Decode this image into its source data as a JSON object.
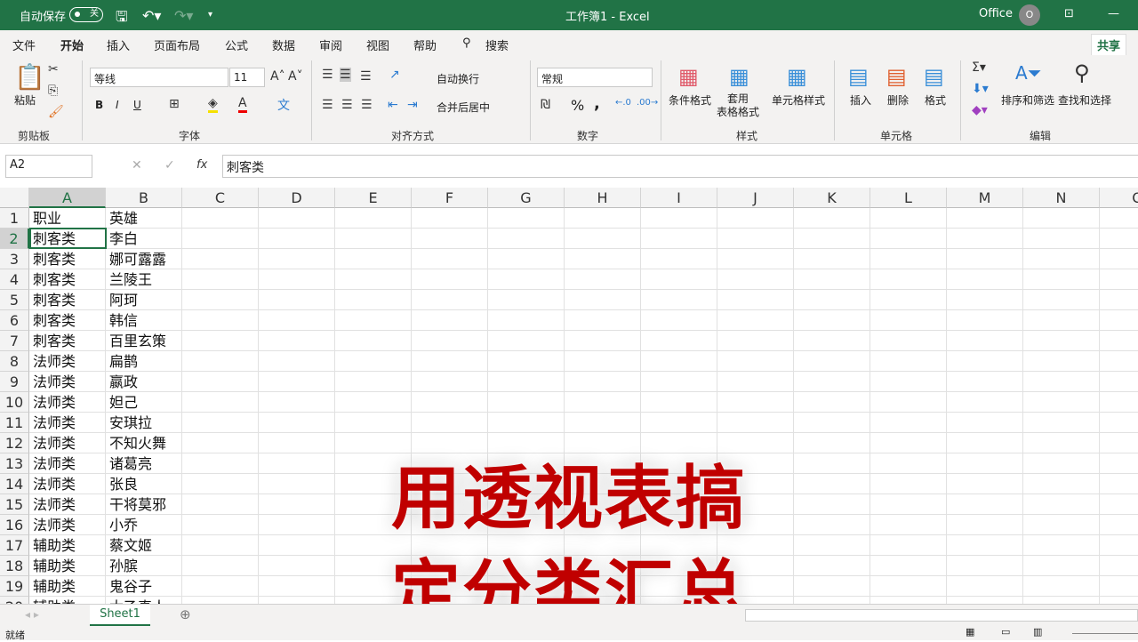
{
  "titlebar": {
    "autosave_label": "自动保存",
    "autosave_state": "关",
    "title": "工作簿1  -  Excel",
    "account": "Office",
    "avatar_initial": "O"
  },
  "menu": {
    "items": [
      "文件",
      "开始",
      "插入",
      "页面布局",
      "公式",
      "数据",
      "审阅",
      "视图",
      "帮助"
    ],
    "search": "搜索",
    "share": "共享"
  },
  "ribbon": {
    "clipboard": {
      "paste": "粘贴",
      "group": "剪贴板"
    },
    "font": {
      "name": "等线",
      "size": "11",
      "bold": "B",
      "italic": "I",
      "underline": "U",
      "group": "字体"
    },
    "alignment": {
      "wrap": "自动换行",
      "merge": "合并后居中",
      "group": "对齐方式"
    },
    "number": {
      "format": "常规",
      "percent": "%",
      "comma": ",",
      "group": "数字"
    },
    "styles": {
      "conditional": "条件格式",
      "table": "套用\n表格格式",
      "cell_styles": "单元格样式",
      "group": "样式"
    },
    "cells": {
      "insert": "插入",
      "delete": "删除",
      "format": "格式",
      "group": "单元格"
    },
    "editing": {
      "sort": "排序和筛选",
      "find": "查找和选择",
      "group": "编辑"
    }
  },
  "formula_bar": {
    "name_box": "A2",
    "fx": "fx",
    "value": "刺客类"
  },
  "columns": [
    "A",
    "B",
    "C",
    "D",
    "E",
    "F",
    "G",
    "H",
    "I",
    "J",
    "K",
    "L",
    "M",
    "N",
    "O"
  ],
  "rows": [
    [
      "职业",
      "英雄"
    ],
    [
      "刺客类",
      "李白"
    ],
    [
      "刺客类",
      "娜可露露"
    ],
    [
      "刺客类",
      "兰陵王"
    ],
    [
      "刺客类",
      "阿珂"
    ],
    [
      "刺客类",
      "韩信"
    ],
    [
      "刺客类",
      "百里玄策"
    ],
    [
      "法师类",
      "扁鹊"
    ],
    [
      "法师类",
      "嬴政"
    ],
    [
      "法师类",
      "妲己"
    ],
    [
      "法师类",
      "安琪拉"
    ],
    [
      "法师类",
      "不知火舞"
    ],
    [
      "法师类",
      "诸葛亮"
    ],
    [
      "法师类",
      "张良"
    ],
    [
      "法师类",
      "干将莫邪"
    ],
    [
      "法师类",
      "小乔"
    ],
    [
      "辅助类",
      "蔡文姬"
    ],
    [
      "辅助类",
      "孙膑"
    ],
    [
      "辅助类",
      "鬼谷子"
    ],
    [
      "辅助类",
      "太乙真人"
    ]
  ],
  "overlay": {
    "line1": "用透视表搞",
    "line2": "定分类汇总"
  },
  "sheet_tabs": [
    "Sheet1"
  ],
  "status": {
    "ready": "就绪"
  }
}
